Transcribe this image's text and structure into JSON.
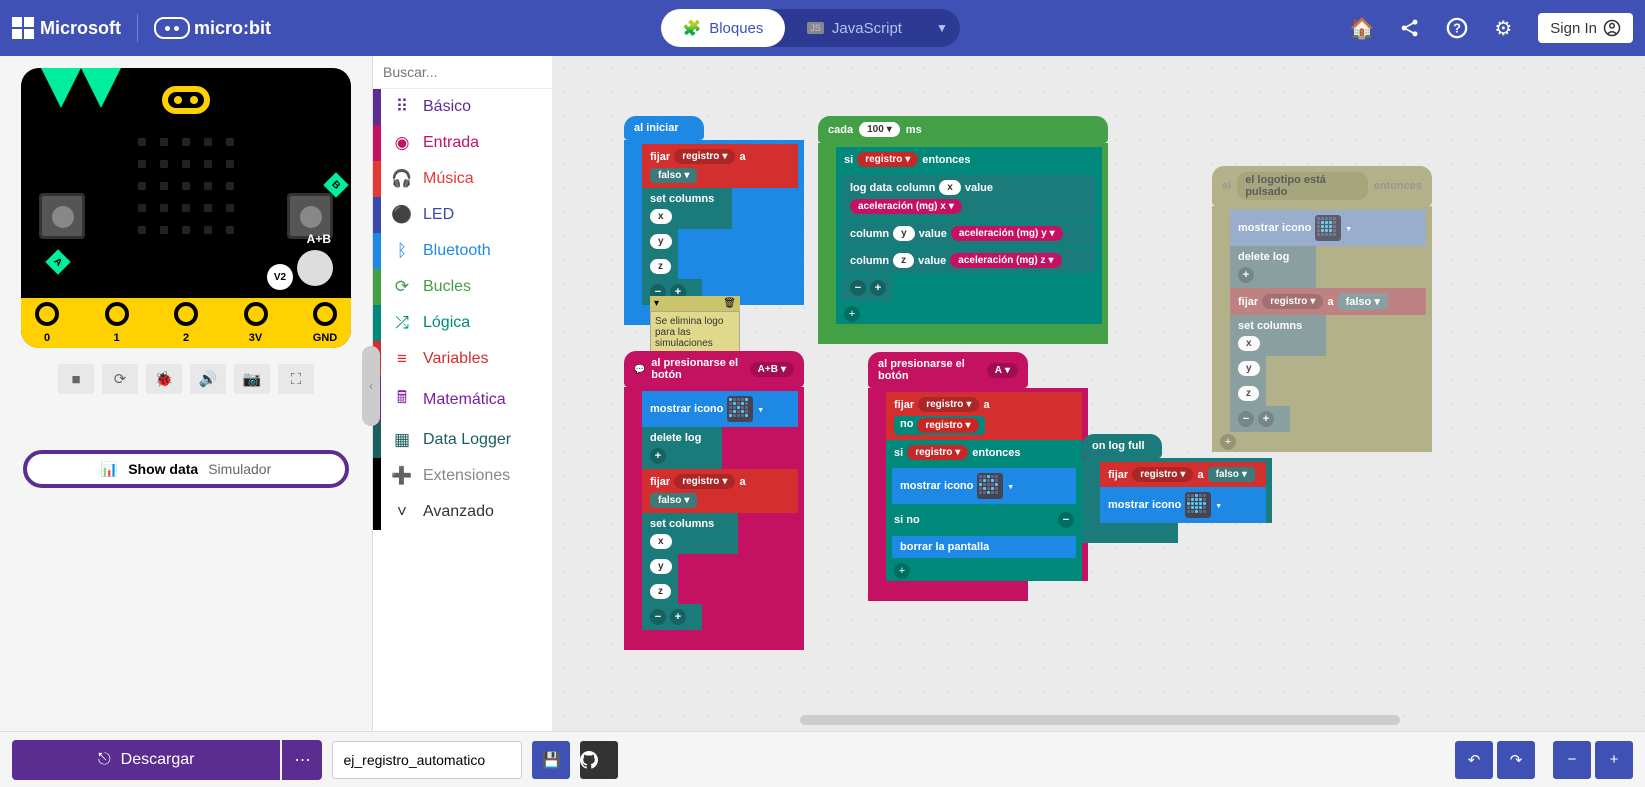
{
  "header": {
    "microsoft": "Microsoft",
    "microbit": "micro:bit",
    "blocks": "Bloques",
    "javascript": "JavaScript",
    "sign_in": "Sign In"
  },
  "search": {
    "placeholder": "Buscar..."
  },
  "categories": [
    {
      "label": "Básico",
      "color": "#5C2D91",
      "icon": "⠿"
    },
    {
      "label": "Entrada",
      "color": "#C51162",
      "icon": "◉"
    },
    {
      "label": "Música",
      "color": "#E53935",
      "icon": "🎧"
    },
    {
      "label": "LED",
      "color": "#3949AB",
      "icon": "⚫"
    },
    {
      "label": "Bluetooth",
      "color": "#1E88E5",
      "icon": "ᛒ"
    },
    {
      "label": "Bucles",
      "color": "#43A047",
      "icon": "⟳"
    },
    {
      "label": "Lógica",
      "color": "#00897B",
      "icon": "⤮"
    },
    {
      "label": "Variables",
      "color": "#D32F2F",
      "icon": "≡"
    },
    {
      "label": "Matemática",
      "color": "#7B1FA2",
      "icon": "🖩"
    },
    {
      "label": "Data Logger",
      "color": "#1B5E5E",
      "icon": "▦"
    },
    {
      "label": "Extensiones",
      "color": "#888",
      "icon": "➕"
    },
    {
      "label": "Avanzado",
      "color": "#333",
      "icon": "˅"
    }
  ],
  "simulator": {
    "pin_labels": [
      "0",
      "1",
      "2",
      "3V",
      "GND"
    ],
    "ab": "A+B",
    "v2": "V2",
    "show_data": "Show data",
    "show_data_sub": "Simulador"
  },
  "blocks": {
    "al_iniciar": "al iniciar",
    "fijar": "fijar",
    "registro": "registro",
    "a_word": "a",
    "falso": "falso",
    "set_columns": "set columns",
    "x": "x",
    "y": "y",
    "z": "z",
    "comment": "Se elimina logo para las simulaciones",
    "cada": "cada",
    "ms": "ms",
    "ms_value": "100",
    "si": "si",
    "entonces": "entonces",
    "log_data": "log data",
    "column": "column",
    "value": "value",
    "accel_x": "aceleración (mg)  x",
    "accel_y": "aceleración (mg)  y",
    "accel_z": "aceleración (mg)  z",
    "al_presionarse_ab": "al presionarse el botón",
    "ab_opt": "A+B",
    "mostrar_icono": "mostrar icono",
    "delete_log": "delete log",
    "al_presionarse_a": "al presionarse el botón",
    "a_opt": "A",
    "no": "no",
    "si_no": "si no",
    "borrar_pantalla": "borrar la pantalla",
    "logotipo_pulsado": "el logotipo está pulsado",
    "on_log_full": "on log full"
  },
  "footer": {
    "download": "Descargar",
    "project_name": "ej_registro_automatico"
  }
}
